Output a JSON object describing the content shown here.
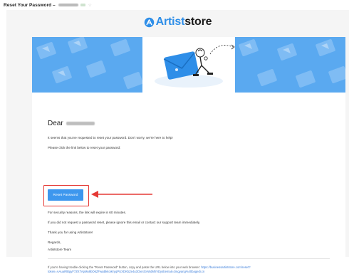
{
  "subject": {
    "title": "Reset Your Password – "
  },
  "logo": {
    "part1": "Artist",
    "part2": "store"
  },
  "email": {
    "greeting": "Dear",
    "line1": "It seems that you've requested to reset your password. Don't worry, we're here to help!",
    "line2": "Please click the link below to reset your password:",
    "button_label": "Reset Password",
    "line3": "For security reasons, the link will expire in 60 minutes.",
    "line4": "If you did not request a password reset, please ignore this email or contact our support team immediately.",
    "line5": "Thank you for using Artiststore!",
    "signoff": "Regards,",
    "signature": "Artiststore Team",
    "fallback_text": "If you're having trouble clicking the \"Reset Password\" button, copy and paste the URL below into your web browser: ",
    "fallback_url": "https://businessartiststore.com/reset?token=AAuaIRBgyF7ZKTApMu9bO6ZFwaBkkoiKryqPUXDKbZe4u3OxrxGvWdMhVDysbemail=zingyang%40bagedi.cn"
  },
  "colors": {
    "brand_blue": "#2e8ee8",
    "button_blue": "#3d97ee",
    "highlight_red": "#e53935",
    "banner_bg": "#5aa9f0"
  }
}
